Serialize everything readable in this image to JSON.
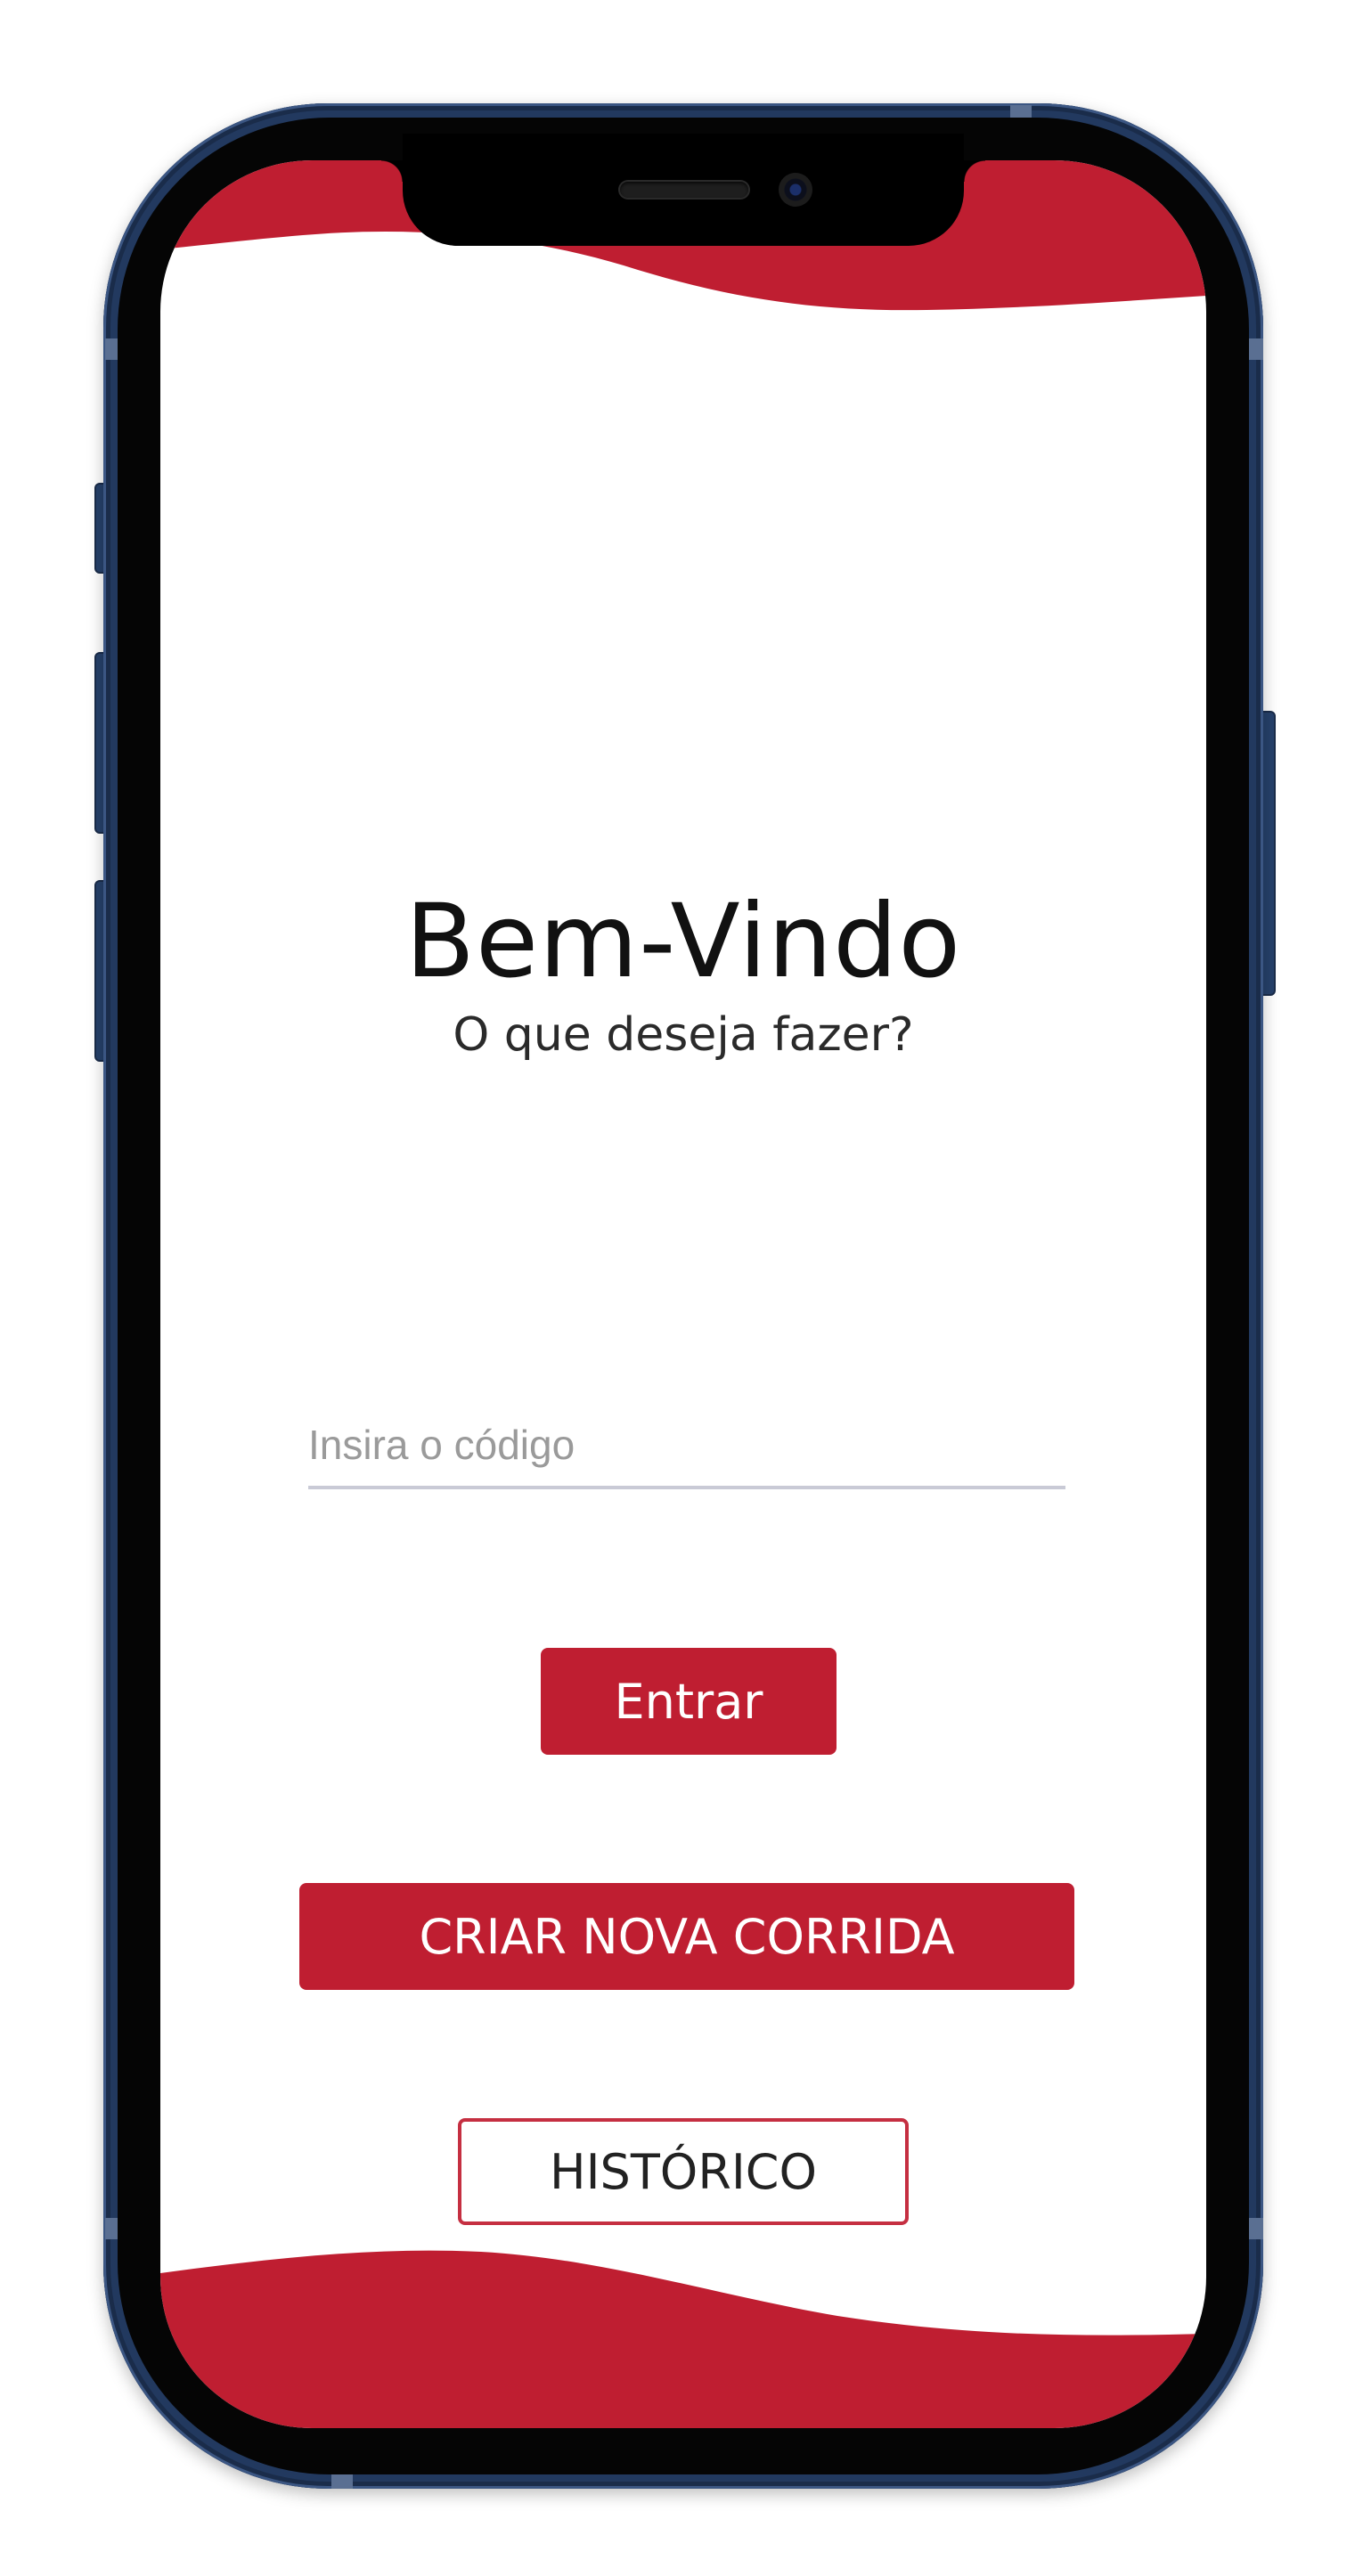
{
  "colors": {
    "accent": "#bf1e31",
    "phone_frame": "#22395f",
    "input_underline": "#c9cad6"
  },
  "welcome": {
    "title": "Bem-Vindo",
    "subtitle": "O que deseja fazer?"
  },
  "code_input": {
    "placeholder": "Insira o código",
    "value": ""
  },
  "buttons": {
    "enter_label": "Entrar",
    "create_label": "CRIAR NOVA CORRIDA",
    "history_label": "HISTÓRICO"
  }
}
